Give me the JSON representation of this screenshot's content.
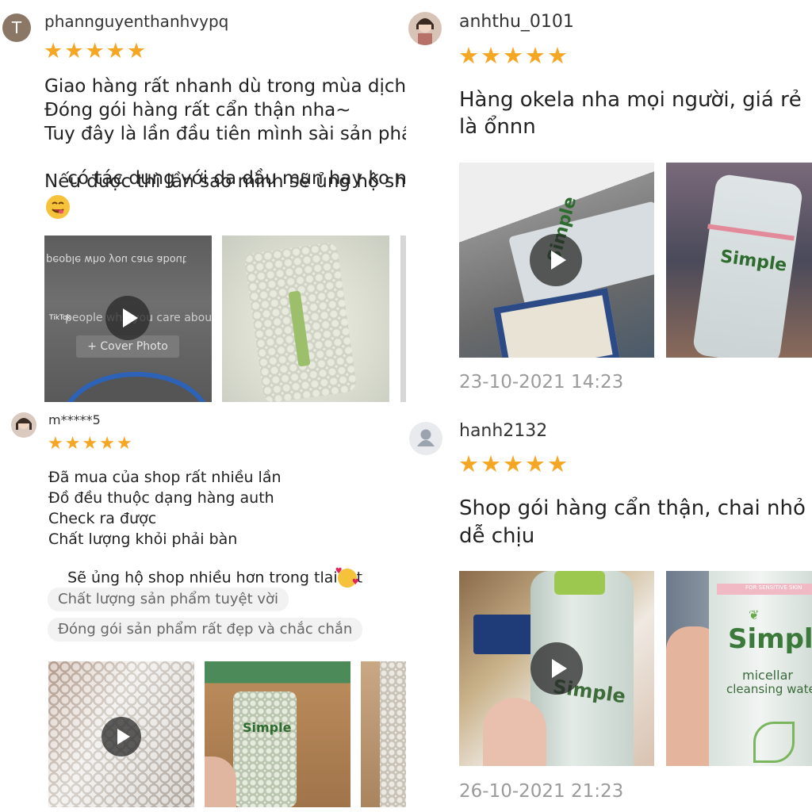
{
  "reviews": [
    {
      "username": "phannguyenthanhvypq",
      "avatar_initial": "T",
      "rating": 5,
      "lines": [
        "Giao hàng rất nhanh dù trong mùa dịch",
        "Đóng gói hàng rất cẩn thận nha~",
        "Tuy đây là lần đầu tiên mình sài sản phẩ",
        "có tác dụng với da dầu mụn hay ko nữa",
        "Nếu được thì lần sao mình sẽ ủng hộ sho"
      ],
      "video_overlay": {
        "mirrored_caption": "people who you care about",
        "tiktok": "TikTok",
        "caption": "people who you care about",
        "button": "+ Cover Photo"
      }
    },
    {
      "username": "anhthu_0101",
      "rating": 5,
      "lines": [
        "Hàng okela nha mọi người, giá rẻ",
        "là ổnnn"
      ],
      "photo_text": "Simple",
      "date": "23-10-2021 14:23"
    },
    {
      "username": "m*****5",
      "rating": 5,
      "lines": [
        "Đã mua của shop rất nhiều lần",
        "Đồ đều thuộc dạng hàng auth",
        "Check ra được",
        "Chất lượng khỏi phải bàn",
        "Sẽ ủng hộ shop nhiều hơn trong tlai"
      ],
      "last_line_suffix": "t",
      "tags": [
        "Chất lượng sản phẩm tuyệt vời",
        "Đóng gói sản phẩm rất đẹp và chắc chắn"
      ],
      "photo_text": "Simple"
    },
    {
      "username": "hanh2132",
      "rating": 5,
      "lines": [
        "Shop gói hàng cẩn thận, chai nhỏ",
        "dễ chịu"
      ],
      "photo_text": {
        "brand": "Simple",
        "line1": "micellar",
        "line2": "cleansing water",
        "small": "FOR SENSITIVE SKIN"
      },
      "date": "26-10-2021 21:23"
    }
  ],
  "icons": {
    "star": "star-icon",
    "play": "play-icon",
    "avatar_placeholder": "user-silhouette-icon"
  },
  "colors": {
    "star": "#f5a623",
    "date": "#9a9a9a",
    "tag_bg": "#f2f2f2"
  }
}
